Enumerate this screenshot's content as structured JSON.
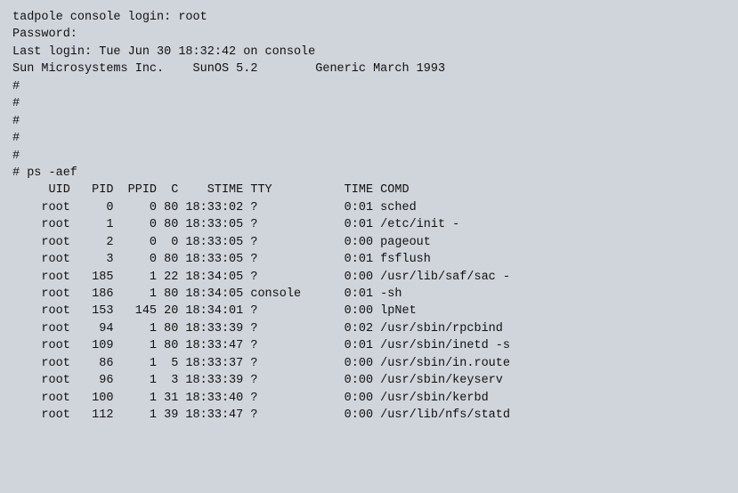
{
  "terminal": {
    "background": "#d0d5dc",
    "text_color": "#111111",
    "lines": [
      "tadpole console login: root",
      "Password:",
      "Last login: Tue Jun 30 18:32:42 on console",
      "Sun Microsystems Inc.    SunOS 5.2        Generic March 1993",
      "#",
      "#",
      "#",
      "#",
      "#",
      "# ps -aef",
      "     UID   PID  PPID  C    STIME TTY          TIME COMD",
      "    root     0     0 80 18:33:02 ?            0:01 sched",
      "    root     1     0 80 18:33:05 ?            0:01 /etc/init -",
      "    root     2     0  0 18:33:05 ?            0:00 pageout",
      "    root     3     0 80 18:33:05 ?            0:01 fsflush",
      "    root   185     1 22 18:34:05 ?            0:00 /usr/lib/saf/sac -",
      "    root   186     1 80 18:34:05 console      0:01 -sh",
      "    root   153   145 20 18:34:01 ?            0:00 lpNet",
      "    root    94     1 80 18:33:39 ?            0:02 /usr/sbin/rpcbind",
      "    root   109     1 80 18:33:47 ?            0:01 /usr/sbin/inetd -s",
      "    root    86     1  5 18:33:37 ?            0:00 /usr/sbin/in.route",
      "    root    96     1  3 18:33:39 ?            0:00 /usr/sbin/keyserv",
      "    root   100     1 31 18:33:40 ?            0:00 /usr/sbin/kerbd",
      "    root   112     1 39 18:33:47 ?            0:00 /usr/lib/nfs/statd"
    ]
  }
}
